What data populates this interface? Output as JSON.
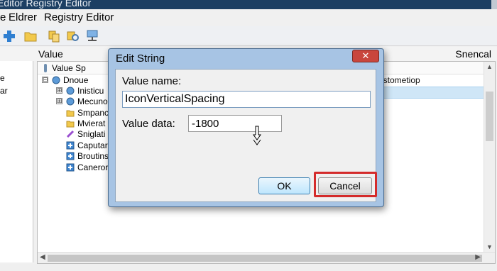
{
  "window": {
    "title": "Editor Registry Editor"
  },
  "menu": {
    "items": [
      "e",
      "Eldrer",
      "Registry Editor"
    ]
  },
  "toolbar": {
    "icons": [
      "add-icon",
      "folder-icon",
      "copy-icon",
      "find-icon",
      "network-icon"
    ]
  },
  "header": {
    "value_label": "Value",
    "right_label": "Snencal"
  },
  "left_pane": {
    "fragments": [
      "e",
      "ar"
    ]
  },
  "tree": {
    "column_label": "Value Sp",
    "right_value": "istometiop",
    "items": [
      {
        "label": "Dnoue",
        "icon": "network-icon",
        "expander": "⊟"
      },
      {
        "label": "Inisticu",
        "icon": "network-icon",
        "expander": "⊞"
      },
      {
        "label": "Mecuno",
        "icon": "network-icon",
        "expander": "⊞"
      },
      {
        "label": "Smpanc",
        "icon": "folder-icon",
        "expander": ""
      },
      {
        "label": "Mvierat",
        "icon": "folder-icon",
        "expander": ""
      },
      {
        "label": "Sniglati",
        "icon": "link-icon",
        "expander": ""
      },
      {
        "label": "Caputar",
        "icon": "doc-icon",
        "expander": ""
      },
      {
        "label": "Broutins",
        "icon": "doc-icon",
        "expander": ""
      },
      {
        "label": "Caneror",
        "icon": "doc-icon",
        "expander": ""
      }
    ]
  },
  "dialog": {
    "title": "Edit String",
    "close_symbol": "✕",
    "value_name_label": "Value name:",
    "value_name": "IconVerticalSpacing",
    "value_data_label": "Value data:",
    "value_data": "-1800",
    "ok_label": "OK",
    "cancel_label": "Cancel",
    "highlight_color": "#d42b2b"
  }
}
